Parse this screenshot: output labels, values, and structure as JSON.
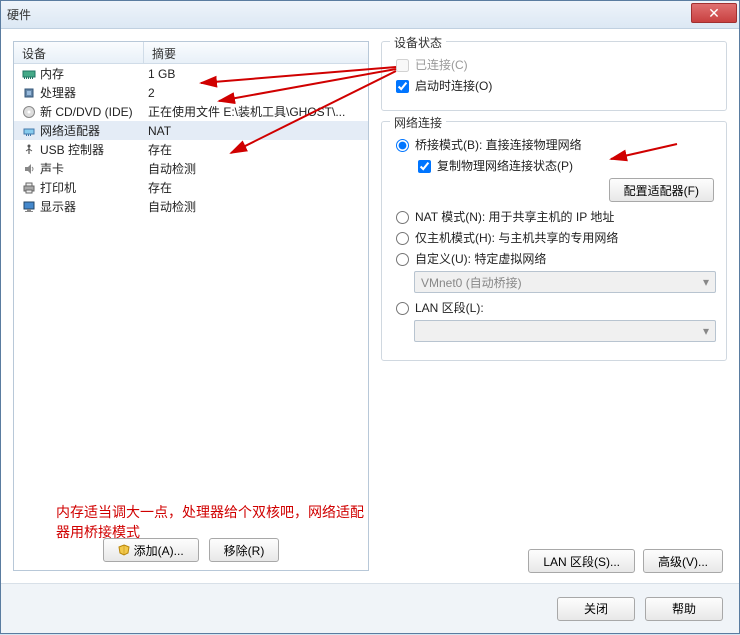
{
  "window": {
    "title": "硬件"
  },
  "columns": {
    "device": "设备",
    "summary": "摘要"
  },
  "devices": [
    {
      "id": "memory",
      "label": "内存",
      "summary": "1 GB"
    },
    {
      "id": "cpu",
      "label": "处理器",
      "summary": "2"
    },
    {
      "id": "cdrom",
      "label": "新 CD/DVD (IDE)",
      "summary": "正在使用文件 E:\\装机工具\\GHOST\\..."
    },
    {
      "id": "nic",
      "label": "网络适配器",
      "summary": "NAT"
    },
    {
      "id": "usb",
      "label": "USB 控制器",
      "summary": "存在"
    },
    {
      "id": "sound",
      "label": "声卡",
      "summary": "自动检测"
    },
    {
      "id": "printer",
      "label": "打印机",
      "summary": "存在"
    },
    {
      "id": "display",
      "label": "显示器",
      "summary": "自动检测"
    }
  ],
  "buttons": {
    "add": "添加(A)...",
    "remove": "移除(R)",
    "close": "关闭",
    "help": "帮助"
  },
  "status_group": {
    "title": "设备状态",
    "connected": "已连接(C)",
    "connect_on_power": "启动时连接(O)"
  },
  "net_group": {
    "title": "网络连接",
    "bridged": "桥接模式(B): 直接连接物理网络",
    "replicate": "复制物理网络连接状态(P)",
    "configure_adapters": "配置适配器(F)",
    "nat": "NAT 模式(N): 用于共享主机的 IP 地址",
    "hostonly": "仅主机模式(H): 与主机共享的专用网络",
    "custom": "自定义(U): 特定虚拟网络",
    "vmnet_placeholder": "VMnet0 (自动桥接)",
    "lan": "LAN 区段(L):",
    "lan_segments_btn": "LAN 区段(S)...",
    "advanced_btn": "高级(V)..."
  },
  "annotation": "内存适当调大一点，处理器给个双核吧，网络适配器用桥接模式"
}
